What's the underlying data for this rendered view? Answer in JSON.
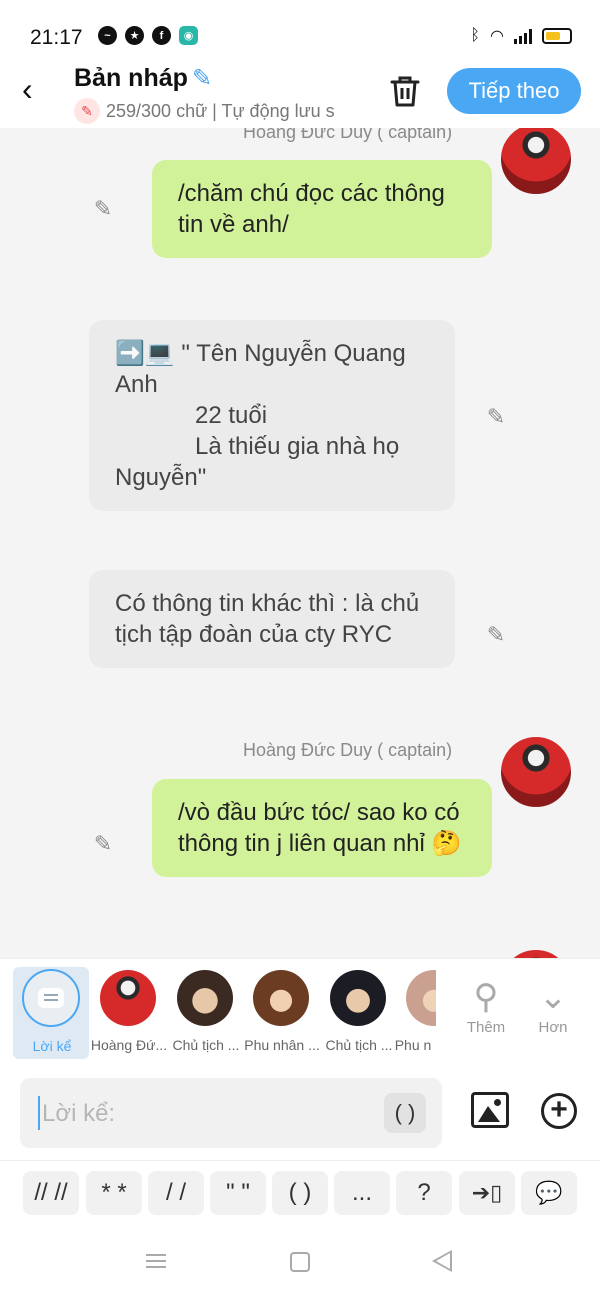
{
  "status_bar": {
    "time": "21:17",
    "notification_icons": [
      "messenger-icon",
      "star-app-icon",
      "facebook-icon",
      "chat-app-icon"
    ],
    "right_icons": [
      "bluetooth-icon",
      "wifi-icon",
      "signal-icon",
      "battery-icon"
    ],
    "battery_level": 0.5
  },
  "header": {
    "title": "Bản nháp",
    "counter": "259/300 chữ",
    "autosave": "| Tự động lưu s",
    "next_label": "Tiếp theo"
  },
  "chat": {
    "messages": [
      {
        "sender": "Hoàng Đức Duy ( captain)",
        "text": "/chăm chú đọc các thông tin về anh/",
        "side": "right",
        "style": "green"
      },
      {
        "text": "➡️💻 \" Tên Nguyễn Quang Anh\n            22 tuổi\n            Là thiếu gia nhà họ Nguyễn\"",
        "side": "left",
        "style": "grey"
      },
      {
        "text": "Có thông tin khác thì : là chủ tịch tập đoàn của cty RYC",
        "side": "left",
        "style": "grey"
      },
      {
        "sender": "Hoàng Đức Duy ( captain)",
        "text": "/vò đầu bức tóc/ sao ko có thông tin j liên quan nhỉ 🤔",
        "side": "right",
        "style": "green"
      }
    ]
  },
  "characters": [
    {
      "name": "Lời kể",
      "selected": true
    },
    {
      "name": "Hoàng Đứ..."
    },
    {
      "name": "Chủ tịch ..."
    },
    {
      "name": "Phu nhân ..."
    },
    {
      "name": "Chủ tịch ..."
    },
    {
      "name": "Phu n"
    }
  ],
  "tools": {
    "add_label": "Thêm",
    "more_label": "Hơn"
  },
  "input": {
    "placeholder": "Lời kể:",
    "paren_label": "( )"
  },
  "shortcuts": [
    "// //",
    "* *",
    "/ /",
    "\" \"",
    "( )",
    "...",
    "?"
  ],
  "colors": {
    "accent": "#4aa7f3",
    "user_bubble": "#d2f29a",
    "narration_bubble": "#ebebeb"
  }
}
